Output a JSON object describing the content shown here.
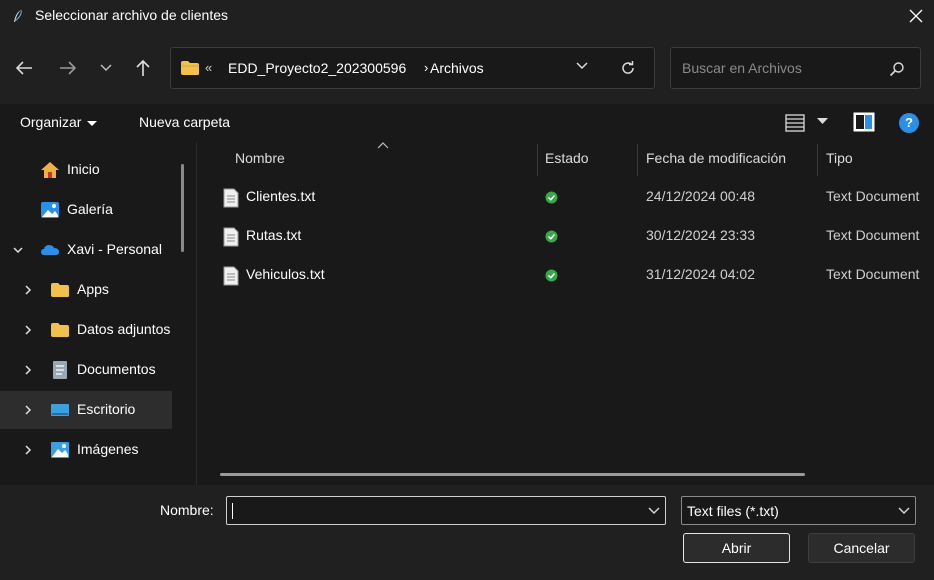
{
  "window": {
    "title": "Seleccionar archivo de clientes"
  },
  "address": {
    "overflow": "«",
    "segment1": "EDD_Proyecto2_202300596",
    "separator": "›",
    "segment2": "Archivos"
  },
  "search": {
    "placeholder": "Buscar en Archivos"
  },
  "commands": {
    "organize": "Organizar",
    "new_folder": "Nueva carpeta",
    "help": "?"
  },
  "sidebar": {
    "items": [
      {
        "label": "Inicio",
        "icon": "home-icon",
        "expandable": false
      },
      {
        "label": "Galería",
        "icon": "gallery-icon",
        "expandable": false
      },
      {
        "label": "Xavi - Personal",
        "icon": "onedrive-cloud-icon",
        "expanded": true
      },
      {
        "label": "Apps",
        "icon": "folder-icon",
        "expandable": true
      },
      {
        "label": "Datos adjuntos",
        "icon": "folder-icon",
        "expandable": true
      },
      {
        "label": "Documentos",
        "icon": "documents-icon",
        "expandable": true
      },
      {
        "label": "Escritorio",
        "icon": "desktop-icon",
        "expandable": true,
        "selected": true
      },
      {
        "label": "Imágenes",
        "icon": "pictures-icon",
        "expandable": true
      }
    ]
  },
  "columns": {
    "name": "Nombre",
    "status": "Estado",
    "modified": "Fecha de modificación",
    "type": "Tipo"
  },
  "files": [
    {
      "name": "Clientes.txt",
      "date": "24/12/2024 00:48",
      "type": "Text Document"
    },
    {
      "name": "Rutas.txt",
      "date": "30/12/2024 23:33",
      "type": "Text Document"
    },
    {
      "name": "Vehiculos.txt",
      "date": "31/12/2024 04:02",
      "type": "Text Document"
    }
  ],
  "bottom": {
    "name_label": "Nombre:",
    "name_value": "",
    "filter": "Text files (*.txt)",
    "open_button": "Abrir",
    "cancel_button": "Cancelar"
  },
  "colors": {
    "accent_blue": "#2a8fe8",
    "folder_yellow": "#f2c04c",
    "status_green": "#3aa54a"
  }
}
